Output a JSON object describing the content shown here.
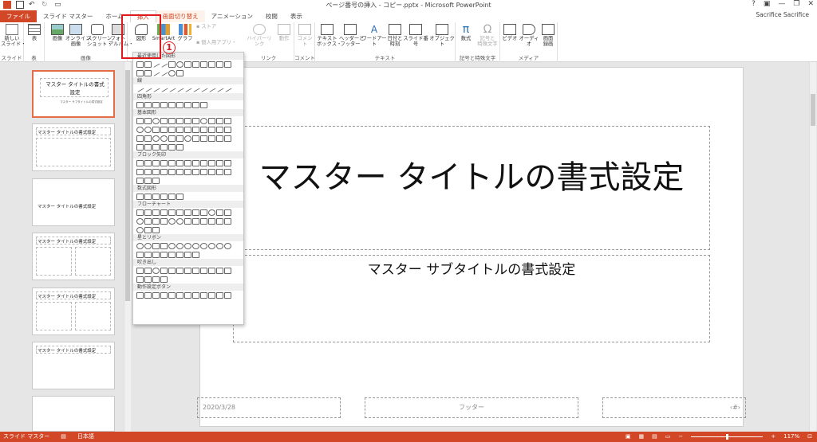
{
  "window": {
    "title": "ページ番号の挿入 - コピー.pptx - Microsoft PowerPoint",
    "user": "Sacrifice Sacrifice",
    "help": "?"
  },
  "tabs": [
    "ファイル",
    "スライド マスター",
    "ホーム",
    "挿入",
    "画面切り替え",
    "アニメーション",
    "校閲",
    "表示"
  ],
  "ribbon": {
    "groups": [
      "スライド",
      "表",
      "画像",
      "リンク",
      "コメント",
      "テキスト",
      "記号と特殊文字",
      "メディア"
    ],
    "buttons": {
      "new_slide": "新しい\nスライド・",
      "table": "表",
      "picture": "画像",
      "online_picture": "オンライン\n画像",
      "screenshot": "スクリーン\nショット・",
      "album": "フォト\nアルバム・",
      "shapes": "図形",
      "smartart": "SmartArt",
      "chart": "グラフ",
      "store": "ストア",
      "my_apps": "個人用アプリ・",
      "hyperlink": "ハイパーリンク",
      "action": "動作",
      "comment": "コメント",
      "textbox": "テキスト\nボックス・",
      "header_footer": "ヘッダーと\nフッター",
      "wordart": "ワードアート",
      "datetime": "日付と\n時刻",
      "slide_number": "スライド番号",
      "object": "オブジェクト",
      "equation": "数式",
      "symbol": "記号と\n特殊文字",
      "video": "ビデオ",
      "audio": "オーディオ",
      "screen_record": "画面\n録画"
    },
    "marker": "1"
  },
  "shapes_menu": {
    "sections": [
      "最近使用した図形",
      "線",
      "四角形",
      "基本図形",
      "ブロック矢印",
      "数式図形",
      "フローチャート",
      "星とリボン",
      "吹き出し",
      "動作設定ボタン"
    ]
  },
  "thumbnails": [
    {
      "title": "マスター タイトルの書式設定",
      "sub": "マスター サブタイトルの書式設定"
    },
    {
      "title": "マスター タイトルの書式設定"
    },
    {
      "title": "マスター タイトルの書式設定"
    },
    {
      "title": "マスター タイトルの書式設定"
    },
    {
      "title": "マスター タイトルの書式設定"
    },
    {
      "title": "マスター タイトルの書式設定"
    }
  ],
  "slide": {
    "title": "マスター タイトルの書式設定",
    "subtitle": "マスター サブタイトルの書式設定",
    "date": "2020/3/28",
    "footer": "フッター",
    "number": "‹#›"
  },
  "status": {
    "view": "スライド マスター",
    "language": "日本語",
    "zoom": "117%",
    "zoom_level": 0.5
  },
  "colors": {
    "accent": "#d24726",
    "selected_thumb": "#e56c46",
    "highlight": "#e0191c"
  }
}
